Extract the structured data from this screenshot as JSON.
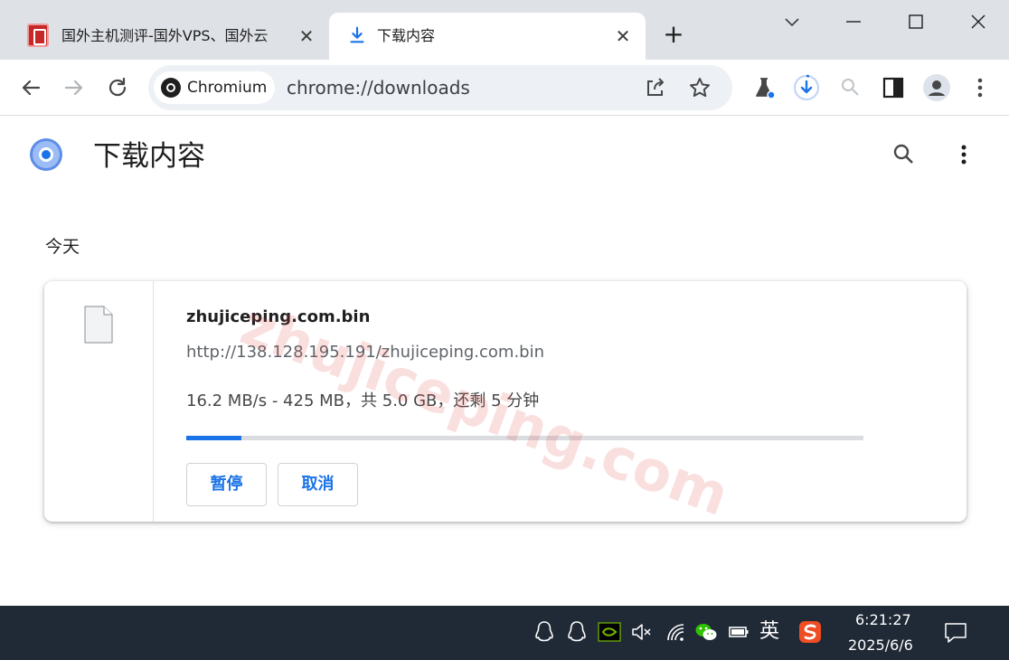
{
  "tabs": [
    {
      "title": "国外主机测评-国外VPS、国外云",
      "close": "✕"
    },
    {
      "title": "下载内容",
      "close": "✕"
    }
  ],
  "new_tab": "+",
  "omnibox": {
    "site_chip": "Chromium",
    "url": "chrome://downloads"
  },
  "page": {
    "title": "下载内容",
    "section_label": "今天"
  },
  "download": {
    "file_name": "zhujiceping.com.bin",
    "url": "http://138.128.195.191/zhujiceping.com.bin",
    "status": "16.2 MB/s - 425 MB，共 5.0 GB，还剩 5 分钟",
    "progress": 0.082,
    "pause_label": "暂停",
    "cancel_label": "取消"
  },
  "watermark": "zhujiceping.com",
  "taskbar": {
    "ime_label": "英",
    "time": "6:21:27",
    "date": "2025/6/6"
  },
  "colors": {
    "accent": "#1a73e8",
    "tabstrip": "#dee1e6",
    "taskbar": "#202a36"
  },
  "icons": [
    "qq-icon",
    "nvidia-icon",
    "volume-muted-icon",
    "wifi-icon",
    "wechat-icon",
    "battery-icon",
    "sogou-input-icon",
    "notification-icon"
  ]
}
